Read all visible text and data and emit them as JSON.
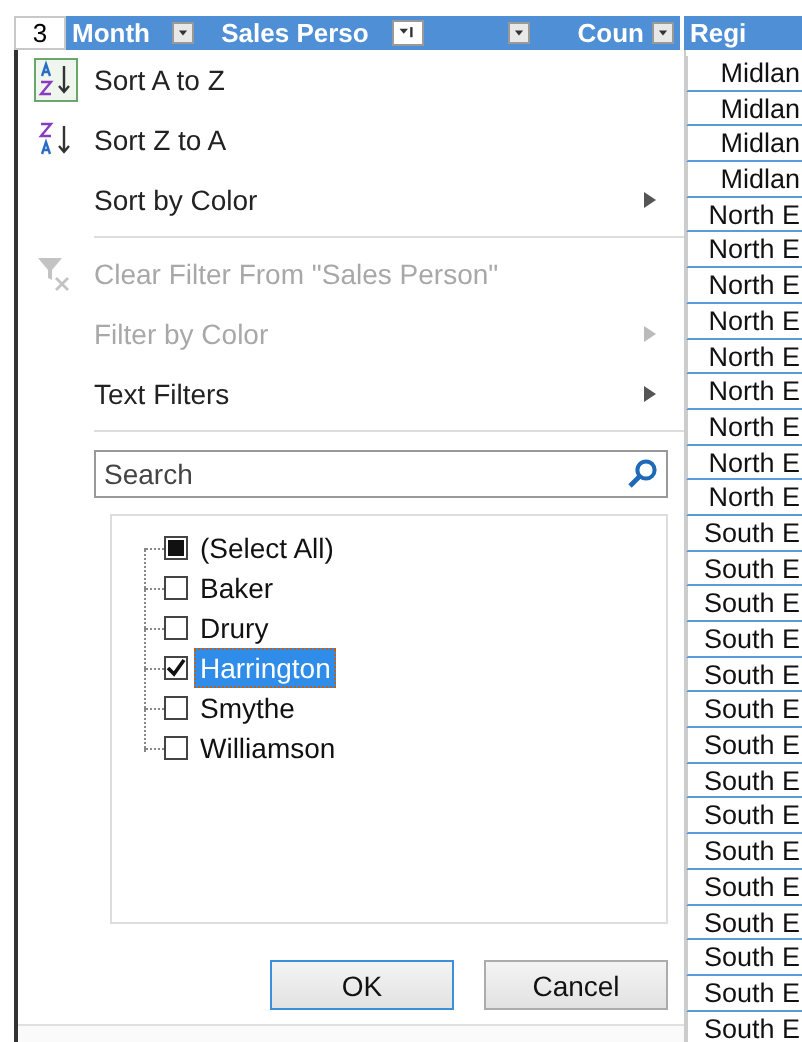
{
  "header": {
    "row_number": "3",
    "columns": [
      {
        "label": "Month",
        "filtered": false
      },
      {
        "label": "Sales Perso",
        "filtered": true
      },
      {
        "filtered": false
      },
      {
        "label": "Coun",
        "filtered": false
      },
      {
        "label": "Regi"
      }
    ]
  },
  "menu": {
    "items": [
      {
        "kind": "sort-asc",
        "label": "Sort A to Z",
        "disabled": false,
        "submenu": false
      },
      {
        "kind": "sort-desc",
        "label": "Sort Z to A",
        "disabled": false,
        "submenu": false
      },
      {
        "kind": "plain",
        "label": "Sort by Color",
        "disabled": false,
        "submenu": true
      },
      {
        "kind": "separator"
      },
      {
        "kind": "clear-filter",
        "label": "Clear Filter From \"Sales Person\"",
        "disabled": true,
        "submenu": false
      },
      {
        "kind": "plain",
        "label": "Filter by Color",
        "disabled": true,
        "submenu": true
      },
      {
        "kind": "plain",
        "label": "Text Filters",
        "disabled": false,
        "submenu": true
      },
      {
        "kind": "separator"
      }
    ],
    "search": {
      "placeholder": "Search"
    },
    "values": [
      {
        "label": "(Select All)",
        "checked": false,
        "indeterminate": true,
        "selected": false
      },
      {
        "label": "Baker",
        "checked": false,
        "indeterminate": false,
        "selected": false
      },
      {
        "label": "Drury",
        "checked": false,
        "indeterminate": false,
        "selected": false
      },
      {
        "label": "Harrington",
        "checked": true,
        "indeterminate": false,
        "selected": true
      },
      {
        "label": "Smythe",
        "checked": false,
        "indeterminate": false,
        "selected": false
      },
      {
        "label": "Williamson",
        "checked": false,
        "indeterminate": false,
        "selected": false
      }
    ],
    "buttons": [
      {
        "label": "OK",
        "default": true
      },
      {
        "label": "Cancel",
        "default": false
      }
    ]
  },
  "region_cells": [
    "Midlan",
    "Midlan",
    "Midlan",
    "Midlan",
    "North E",
    "North E",
    "North E",
    "North E",
    "North E",
    "North E",
    "North E",
    "North E",
    "North E",
    "South E",
    "South E",
    "South E",
    "South E",
    "South E",
    "South E",
    "South E",
    "South E",
    "South E",
    "South E",
    "South E",
    "South E",
    "South E",
    "South E",
    "South E"
  ]
}
